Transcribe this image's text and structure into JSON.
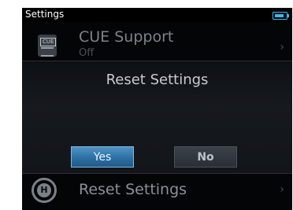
{
  "status_bar": {
    "title": "Settings",
    "battery_icon": "battery-icon",
    "accent_color": "#39b9f3"
  },
  "menu": {
    "items": [
      {
        "label": "CUE Support",
        "sub": "Off",
        "icon": "cue-file-icon"
      },
      {
        "label": "Reset Settings",
        "icon": "reset-icon"
      }
    ]
  },
  "dialog": {
    "title": "Reset Settings",
    "buttons": {
      "yes": "Yes",
      "no": "No"
    },
    "selected": "yes"
  }
}
